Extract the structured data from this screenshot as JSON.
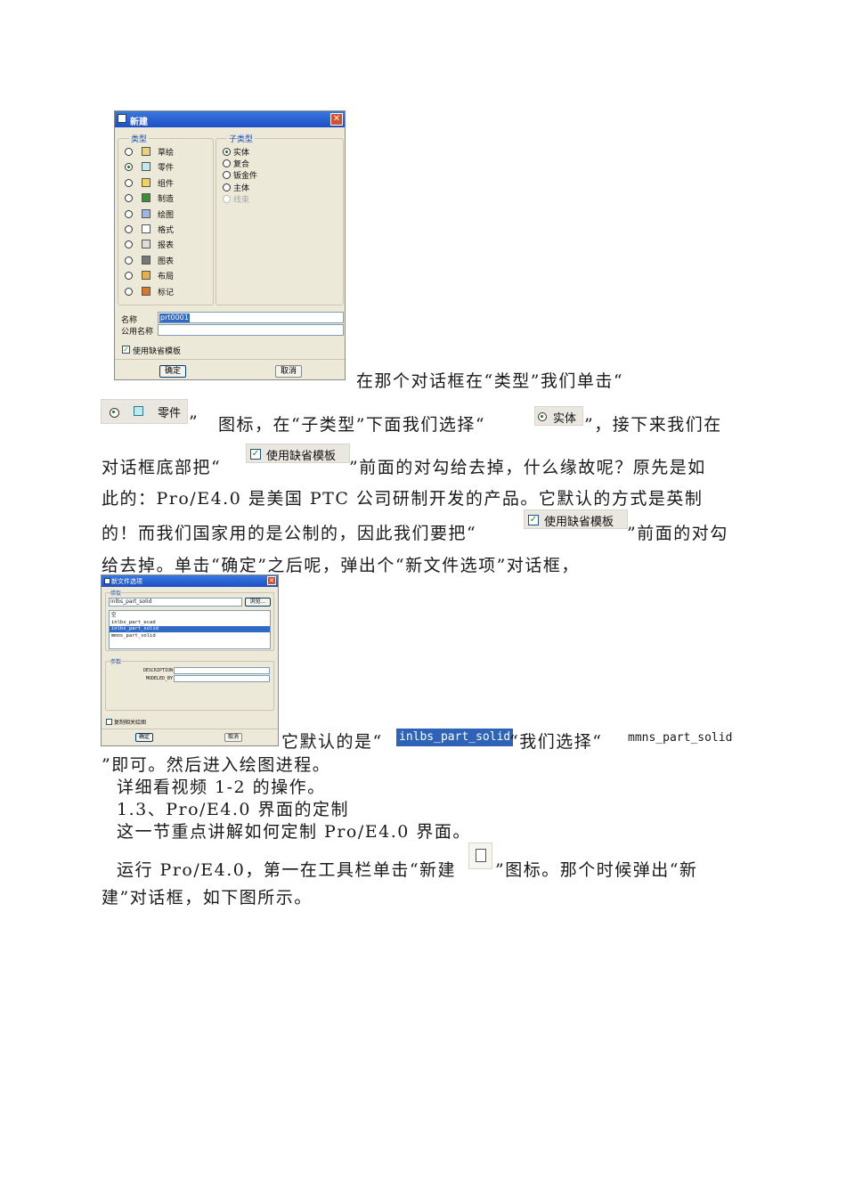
{
  "dialog_new": {
    "title": "新建",
    "type_group_label": "类型",
    "subtype_group_label": "子类型",
    "types": [
      "草绘",
      "零件",
      "组件",
      "制造",
      "绘图",
      "格式",
      "报表",
      "图表",
      "布局",
      "标记"
    ],
    "selected_type": "零件",
    "subtypes": [
      "实体",
      "复合",
      "钣金件",
      "主体",
      "线束"
    ],
    "selected_subtype": "实体",
    "disabled_subtype": "线束",
    "name_label": "名称",
    "name_value": "prt0001",
    "common_name_label": "公用名称",
    "common_name_value": "",
    "use_default_template_label": "使用缺省模板",
    "ok_label": "确定",
    "cancel_label": "取消"
  },
  "dialog_file_options": {
    "title": "新文件选项",
    "template_label": "模板",
    "template_value": "inlbs_part_solid",
    "browse_label": "浏览...",
    "template_list": [
      "空",
      "inlbs_part_ecad",
      "inlbs_part_solid",
      "mmns_part_solid"
    ],
    "selected_template": "inlbs_part_solid",
    "params_label": "参数",
    "param_names": [
      "DESCRIPTION",
      "MODELED_BY"
    ],
    "copy_drawing_label": "复制相关绘图",
    "ok_label": "确定",
    "cancel_label": "取消"
  },
  "text": {
    "line1": "在那个对话框在“类型”我们单击“",
    "chip_part": "零件",
    "line2a": "”",
    "line2b": "图标，在“子类型”下面我们选择“",
    "chip_solid": "实体",
    "line2c": "”，接下来我们在",
    "line3a": "对话框底部把“",
    "chip_template": "使用缺省模板",
    "line3b": "”前面的对勾给去掉，什么缘故呢？原先是如",
    "line4": "此的：Pro/E4.0 是美国 PTC 公司研制开发的产品。它默认的方式是英制",
    "line5a": "的！而我们国家用的是公制的，因此我们要把“",
    "line5b": "”前面的对勾",
    "line6": "给去掉。单击“确定”之后呢，弹出个“新文件选项”对话框，",
    "line7a": "它默认的是“",
    "hl_default": "inlbs_part_solid",
    "line7b": "“我们选择“",
    "mono_choice": "mmns_part_solid",
    "line8": "”即可。然后进入绘图进程。",
    "line9": "详细看视频 1-2 的操作。",
    "line10": "1.3、Pro/E4.0 界面的定制",
    "line11": "这一节重点讲解如何定制 Pro/E4.0 界面。",
    "line12a": "运行 Pro/E4.0，第一在工具栏单击“新建",
    "line12b": "”图标。那个时候弹出“新",
    "line13": "建”对话框，如下图所示。"
  }
}
